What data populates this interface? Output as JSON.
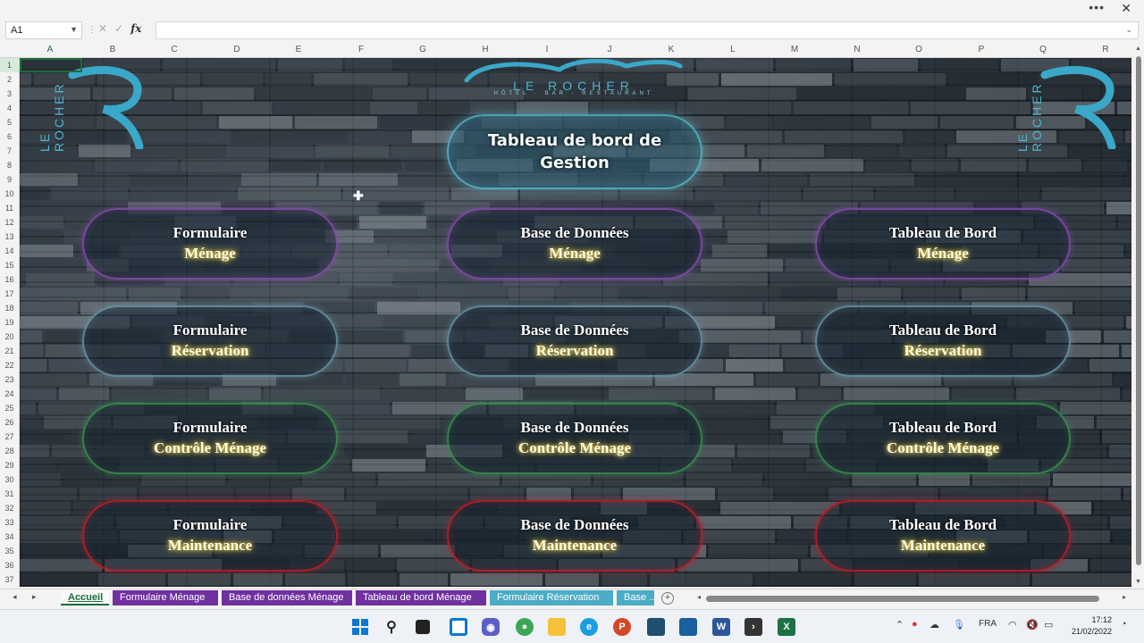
{
  "window": {
    "more_icon": "more-icon",
    "close_glyph": "✕"
  },
  "formula_bar": {
    "name_box": "A1",
    "formula": "",
    "fx": "fx"
  },
  "columns": [
    "A",
    "B",
    "C",
    "D",
    "E",
    "F",
    "G",
    "H",
    "I",
    "J",
    "K",
    "L",
    "M",
    "N",
    "O",
    "P",
    "Q",
    "R"
  ],
  "rows": [
    "1",
    "2",
    "3",
    "4",
    "5",
    "6",
    "7",
    "8",
    "9",
    "10",
    "11",
    "12",
    "13",
    "14",
    "15",
    "16",
    "17",
    "18",
    "19",
    "20",
    "21",
    "22",
    "23",
    "24",
    "25",
    "26",
    "27",
    "28",
    "29",
    "30",
    "31",
    "32",
    "33",
    "34",
    "35",
    "36",
    "37"
  ],
  "branding": {
    "logo_name": "LE ROCHER",
    "logo_tagline": "HÔTEL · BAR · RESTAURANT",
    "side_text": "LE ROCHER",
    "brand_color": "#4fb3cf"
  },
  "dashboard": {
    "title": "Tableau de bord de Gestion",
    "buttons": [
      {
        "line1": "Formulaire",
        "line2": "Ménage",
        "color": "purple"
      },
      {
        "line1": "Base de Données",
        "line2": "Ménage",
        "color": "purple"
      },
      {
        "line1": "Tableau de Bord",
        "line2": "Ménage",
        "color": "purple"
      },
      {
        "line1": "Formulaire",
        "line2": "Réservation",
        "color": "blue"
      },
      {
        "line1": "Base de Données",
        "line2": "Réservation",
        "color": "blue"
      },
      {
        "line1": "Tableau de Bord",
        "line2": "Réservation",
        "color": "blue"
      },
      {
        "line1": "Formulaire",
        "line2": "Contrôle Ménage",
        "color": "green"
      },
      {
        "line1": "Base de Données",
        "line2": "Contrôle Ménage",
        "color": "green"
      },
      {
        "line1": "Tableau de Bord",
        "line2": "Contrôle Ménage",
        "color": "green"
      },
      {
        "line1": "Formulaire",
        "line2": "Maintenance",
        "color": "red"
      },
      {
        "line1": "Base de Données",
        "line2": "Maintenance",
        "color": "red"
      },
      {
        "line1": "Tableau de Bord",
        "line2": "Maintenance",
        "color": "red"
      }
    ]
  },
  "sheet_tabs": [
    {
      "label": "Accueil",
      "active": true,
      "color": "#f8f8f8"
    },
    {
      "label": "Formulaire Ménage",
      "active": false,
      "color": "#7030a0"
    },
    {
      "label": "Base de données Ménage",
      "active": false,
      "color": "#7030a0"
    },
    {
      "label": "Tableau de bord Ménage",
      "active": false,
      "color": "#7030a0"
    },
    {
      "label": "Formulaire Réservation",
      "active": false,
      "color": "#4bacc6"
    },
    {
      "label": "Base ...",
      "active": false,
      "color": "#4bacc6"
    }
  ],
  "taskbar": {
    "language": "FRA",
    "time": "17:12",
    "date": "21/02/2022"
  }
}
